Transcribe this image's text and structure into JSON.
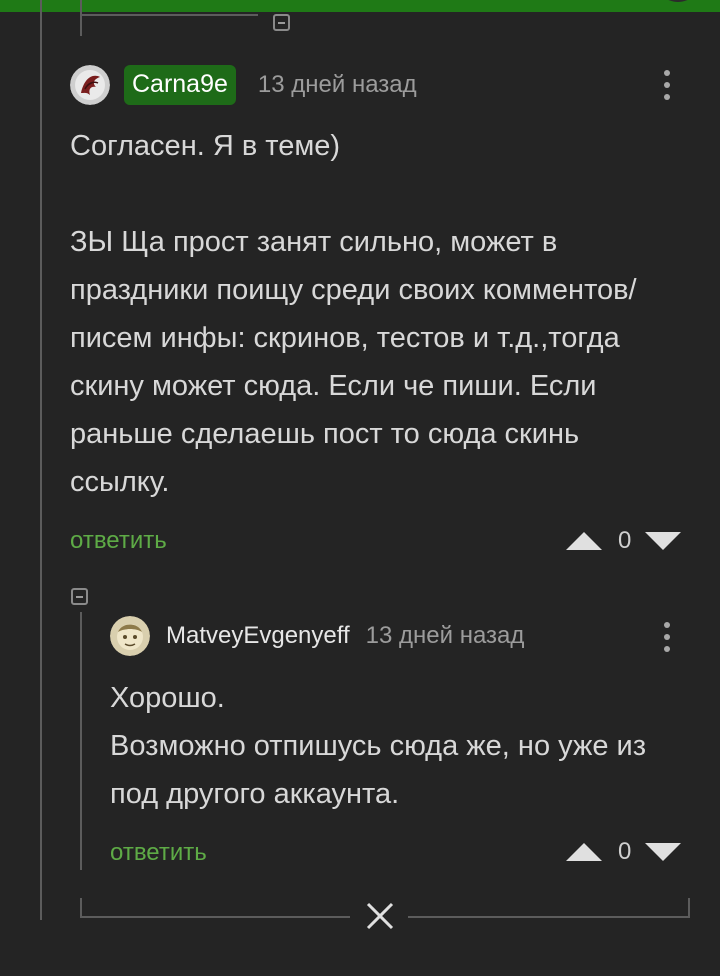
{
  "comments": [
    {
      "author": "Carna9e",
      "time": "13 дней назад",
      "text": "Согласен. Я в теме)\n\nЗЫ Ща прост занят сильно, может в праздники поищу среди своих комментов/писем инфы: скринов, тестов и т.д.,тогда скину может сюда. Если че пиши. Если раньше сделаешь пост то сюда скинь ссылку.",
      "reply_label": "ответить",
      "rating": "0"
    },
    {
      "author": "MatveyEvgenyeff",
      "time": "13 дней назад",
      "text": "Хорошо.\nВозможно отпишусь сюда же, но уже из под другого аккаунта.",
      "reply_label": "ответить",
      "rating": "0"
    }
  ],
  "colors": {
    "accent": "#1e6b18",
    "reply": "#5eab46",
    "background": "#242424"
  }
}
